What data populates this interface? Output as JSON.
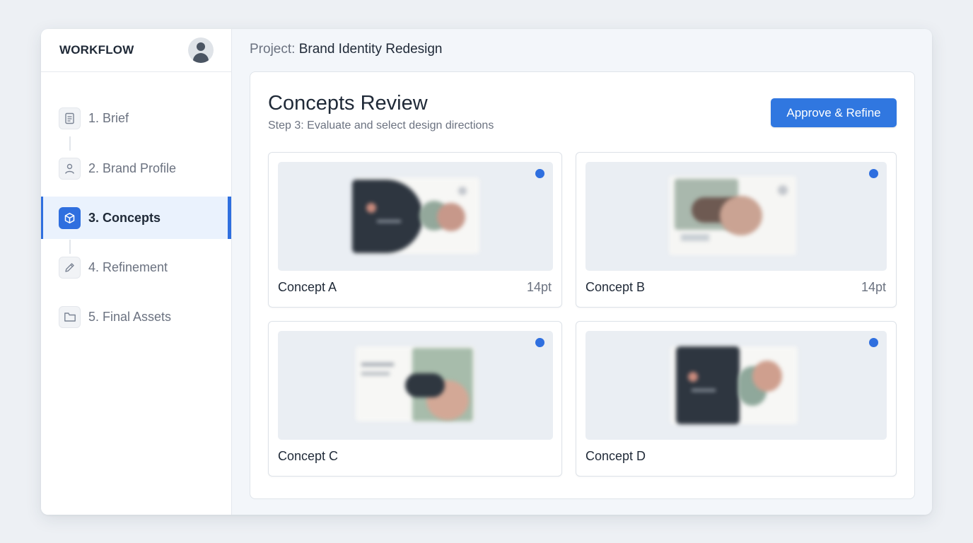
{
  "sidebar": {
    "brand": "WORKFLOW",
    "steps": [
      {
        "label": "1. Brief",
        "icon": "document-icon"
      },
      {
        "label": "2. Brand Profile",
        "icon": "user-icon"
      },
      {
        "label": "3. Concepts",
        "icon": "cube-icon",
        "active": true
      },
      {
        "label": "4. Refinement",
        "icon": "pencil-icon"
      },
      {
        "label": "5. Final Assets",
        "icon": "folder-icon"
      }
    ]
  },
  "header": {
    "project_prefix": "Project: ",
    "project_name": "Brand Identity Redesign"
  },
  "panel": {
    "title": "Concepts Review",
    "subtitle": "Step 3: Evaluate and select design directions",
    "primary_action": "Approve & Refine"
  },
  "concepts": [
    {
      "name": "Concept A",
      "size": "14pt"
    },
    {
      "name": "Concept B",
      "size": "14pt"
    },
    {
      "name": "Concept C",
      "size": ""
    },
    {
      "name": "Concept D",
      "size": ""
    }
  ],
  "colors": {
    "accent": "#2f6fdf",
    "button": "#3077e0",
    "active_bg": "#eaf2fd",
    "page_bg": "#edf0f4"
  }
}
